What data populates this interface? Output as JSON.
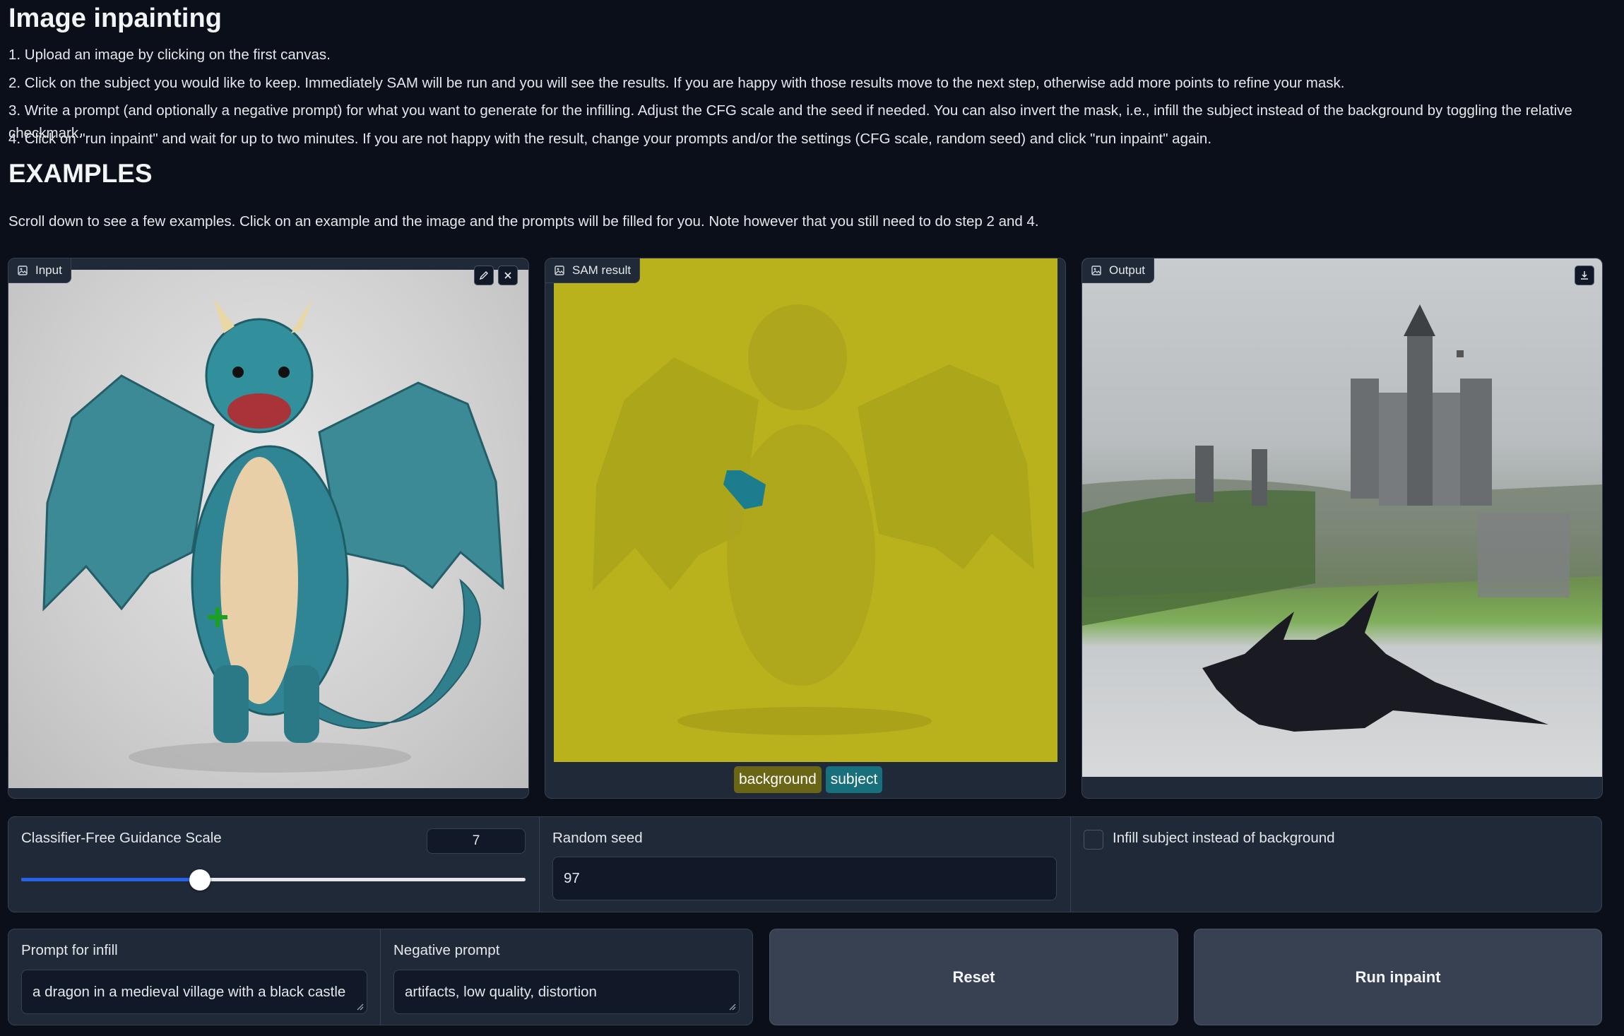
{
  "header": {
    "title": "Image inpainting"
  },
  "steps": [
    "1. Upload an image by clicking on the first canvas.",
    "2. Click on the subject you would like to keep. Immediately SAM will be run and you will see the results. If you are happy with those results move to the next step, otherwise add more points to refine your mask.",
    "3. Write a prompt (and optionally a negative prompt) for what you want to generate for the infilling. Adjust the CFG scale and the seed if needed. You can also invert the mask, i.e., infill the subject instead of the background by toggling the relative checkmark.",
    "4. Click on \"run inpaint\" and wait for up to two minutes. If you are not happy with the result, change your prompts and/or the settings (CFG scale, random seed) and click \"run inpaint\" again."
  ],
  "examples": {
    "heading": "EXAMPLES",
    "note": "Scroll down to see a few examples. Click on an example and the image and the prompts will be filled for you. Note however that you still need to do step 2 and 4."
  },
  "panels": {
    "input": {
      "label": "Input",
      "icon": "image-icon"
    },
    "sam": {
      "label": "SAM result",
      "icon": "image-icon",
      "legend": [
        "background",
        "subject"
      ]
    },
    "output": {
      "label": "Output",
      "icon": "image-icon"
    }
  },
  "controls": {
    "cfg": {
      "label": "Classifier-Free Guidance Scale",
      "value": "7",
      "slider_fraction": 0.355
    },
    "seed": {
      "label": "Random seed",
      "value": "97"
    },
    "invert": {
      "label": "Infill subject instead of background",
      "checked": false
    }
  },
  "prompts": {
    "prompt": {
      "label": "Prompt for infill",
      "value": "a dragon in a medieval village with a black castle"
    },
    "negative": {
      "label": "Negative prompt",
      "value": "artifacts, low quality, distortion"
    }
  },
  "buttons": {
    "reset": "Reset",
    "run": "Run inpaint"
  },
  "colors": {
    "background": "#0b0f19",
    "panel": "#1f2937",
    "border": "#374151",
    "mask_background": "#b6b018",
    "mask_subject": "#1b7d8d",
    "slider_fill": "#2563eb"
  }
}
